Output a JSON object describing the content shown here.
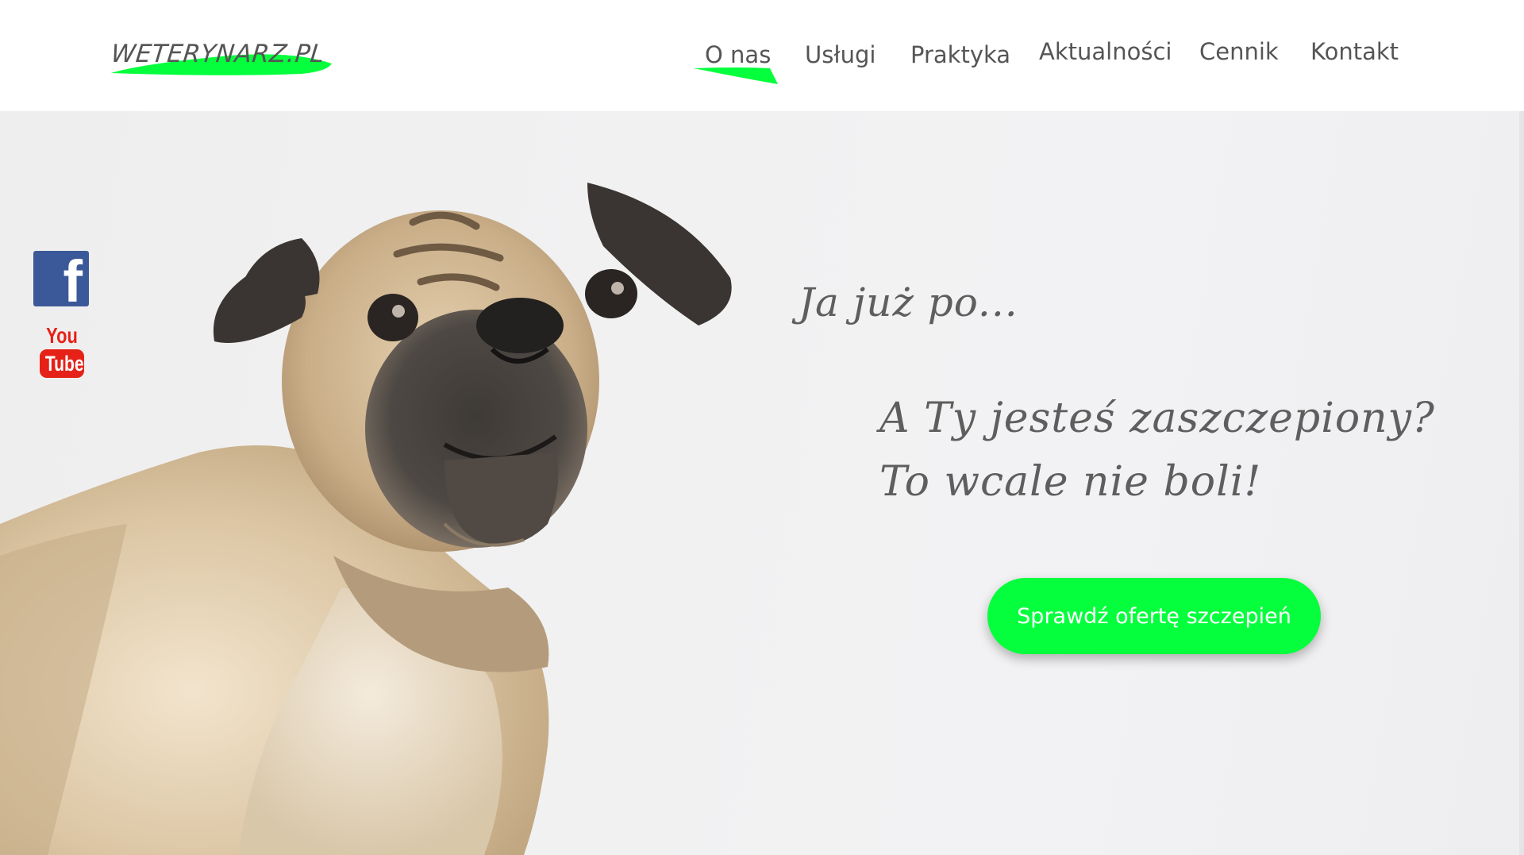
{
  "header": {
    "logo_text": "WETERYNARZ.PL",
    "nav": [
      {
        "label": "O nas",
        "active": true
      },
      {
        "label": "Usługi",
        "active": false
      },
      {
        "label": "Praktyka",
        "active": false
      },
      {
        "label": "Aktualności",
        "active": false
      },
      {
        "label": "Cennik",
        "active": false
      },
      {
        "label": "Kontakt",
        "active": false
      }
    ]
  },
  "social": {
    "facebook_glyph": "f",
    "youtube_you": "You",
    "youtube_tube": "Tube"
  },
  "hero": {
    "line1": "Ja już po...",
    "line2": "A Ty jesteś zaszczepiony?",
    "line3": "To wcale nie boli!",
    "cta_label": "Sprawdź ofertę szczepień"
  },
  "colors": {
    "accent_green": "#05ff3c",
    "text_gray": "#555555",
    "facebook_blue": "#3b5998",
    "youtube_red": "#e62117"
  },
  "icons": [
    "facebook-icon",
    "youtube-icon"
  ]
}
